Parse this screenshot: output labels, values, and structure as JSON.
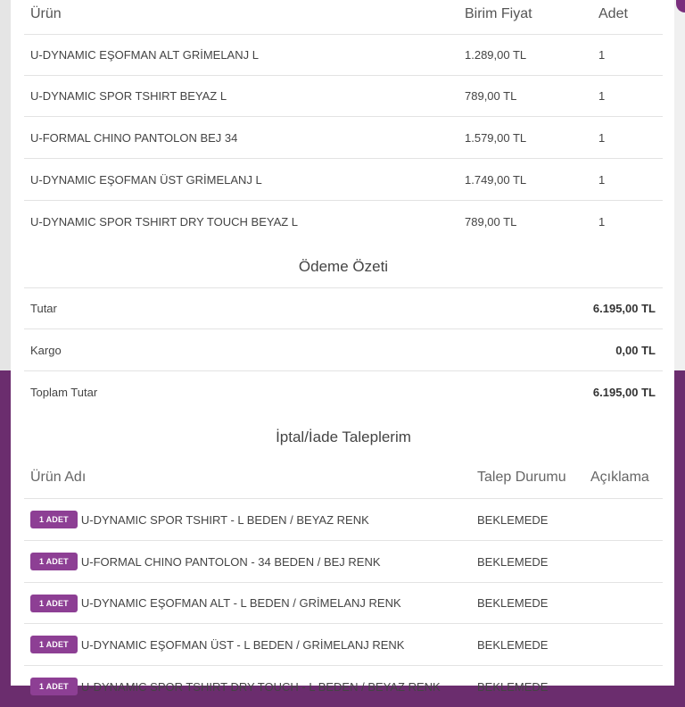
{
  "order_items": {
    "headers": {
      "product": "Ürün",
      "unit_price": "Birim Fiyat",
      "quantity": "Adet"
    },
    "rows": [
      {
        "name": "U-DYNAMIC EŞOFMAN ALT GRİMELANJ L",
        "price": "1.289,00 TL",
        "qty": "1"
      },
      {
        "name": "U-DYNAMIC SPOR TSHIRT BEYAZ L",
        "price": "789,00 TL",
        "qty": "1"
      },
      {
        "name": "U-FORMAL CHINO PANTOLON BEJ 34",
        "price": "1.579,00 TL",
        "qty": "1"
      },
      {
        "name": "U-DYNAMIC EŞOFMAN ÜST GRİMELANJ L",
        "price": "1.749,00 TL",
        "qty": "1"
      },
      {
        "name": "U-DYNAMIC SPOR TSHIRT DRY TOUCH BEYAZ L",
        "price": "789,00 TL",
        "qty": "1"
      }
    ]
  },
  "payment_summary": {
    "title": "Ödeme Özeti",
    "rows": [
      {
        "label": "Tutar",
        "value": "6.195,00 TL"
      },
      {
        "label": "Kargo",
        "value": "0,00 TL"
      },
      {
        "label": "Toplam Tutar",
        "value": "6.195,00 TL"
      }
    ]
  },
  "returns": {
    "title": "İptal/İade Taleplerim",
    "headers": {
      "product_name": "Ürün Adı",
      "status": "Talep Durumu",
      "description": "Açıklama"
    },
    "rows": [
      {
        "badge": "1 ADET",
        "name": "U-DYNAMIC SPOR TSHIRT - L BEDEN / BEYAZ RENK",
        "status": "BEKLEMEDE",
        "description": ""
      },
      {
        "badge": "1 ADET",
        "name": "U-FORMAL CHINO PANTOLON - 34 BEDEN / BEJ RENK",
        "status": "BEKLEMEDE",
        "description": ""
      },
      {
        "badge": "1 ADET",
        "name": "U-DYNAMIC EŞOFMAN ALT - L BEDEN / GRİMELANJ RENK",
        "status": "BEKLEMEDE",
        "description": ""
      },
      {
        "badge": "1 ADET",
        "name": "U-DYNAMIC EŞOFMAN ÜST - L BEDEN / GRİMELANJ RENK",
        "status": "BEKLEMEDE",
        "description": ""
      },
      {
        "badge": "1 ADET",
        "name": "U-DYNAMIC SPOR TSHIRT DRY TOUCH - L BEDEN / BEYAZ RENK",
        "status": "BEKLEMEDE",
        "description": ""
      }
    ]
  },
  "colors": {
    "brand": "#6b2d6e",
    "badge": "#8d3f94"
  }
}
